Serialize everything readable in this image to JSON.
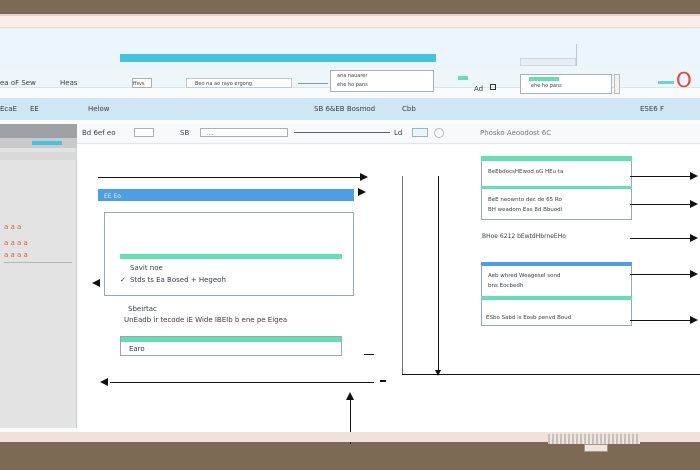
{
  "header": {
    "left_text_1": "ea oF Sew",
    "left_text_2": "Heas",
    "search_hint": "Beo na ao rayo ergong",
    "box_text": "ffsvs",
    "right_box_1": "ana nauarer",
    "right_box_2": "ehe ho pans",
    "mini_label": "Ad",
    "brand_mark": "O"
  },
  "menubar": {
    "left_a": "EcaE",
    "left_b": "EE",
    "left_c": "Helow",
    "center_a": "SB 6&EB Bosmod",
    "center_b": "Cbb",
    "right_a": "ESE6 F"
  },
  "toolbar": {
    "label_a": "Bd 6ef eo",
    "label_b": "SB",
    "label_c": "Ld",
    "field_value": "....",
    "tail_text": "Phosko Aeoodost 6C"
  },
  "sidebar": {
    "row_labels": [
      "a a a",
      "a a a a",
      "a a a a"
    ]
  },
  "canvas": {
    "left_header": "EE Eo",
    "save_title": "Savit noe",
    "save_subtitle": "Stds ts Ea Bosed + Hegeoh",
    "section_title": "Sbeirtac",
    "section_text": "UnEadb ir tecode iE Wide IBEIb b ene pe Eigea",
    "foot_label": "Earo",
    "right_row_1": "BeEbdocsHEwod oG HEu ta",
    "right_row_2": "BeE neownto dec de 65 Ro",
    "right_row_3": "BH weadom Eas 8d Bbuodi",
    "right_row_4": "BHoe 6212 bEwtdHbrneEHo",
    "right_row_5": "Aeb whred Weagesel sond",
    "right_row_6": "bns Eocbedh",
    "right_row_7": "ESbo Sabd is Eosb penvd Boud"
  },
  "colors": {
    "accent_teal": "#43c5df",
    "accent_green": "#63e0b3",
    "accent_blue": "#4a9fe7",
    "brand_red": "#e0463d"
  }
}
